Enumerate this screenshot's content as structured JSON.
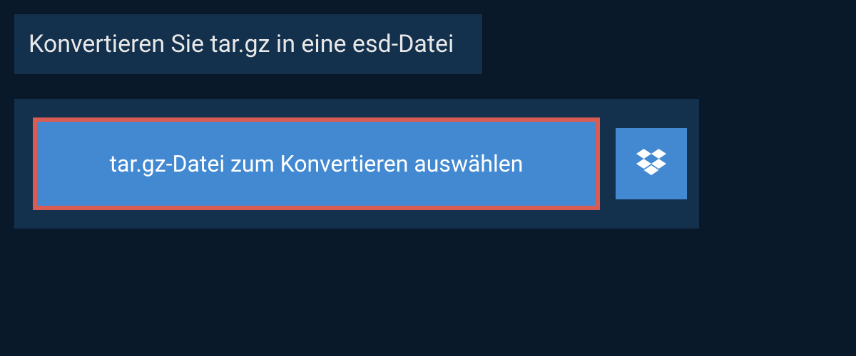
{
  "heading": {
    "title": "Konvertieren Sie tar.gz in eine esd-Datei"
  },
  "upload": {
    "select_label": "tar.gz-Datei zum Konvertieren auswählen"
  },
  "colors": {
    "page_bg": "#0a1929",
    "panel_bg": "#13304d",
    "button_bg": "#4289d1",
    "highlight_border": "#d95c54",
    "text_light": "#e8e8e8",
    "text_white": "#ffffff"
  }
}
